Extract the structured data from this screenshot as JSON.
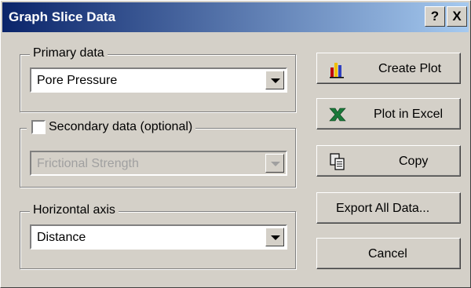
{
  "window": {
    "title": "Graph Slice Data",
    "help_label": "?",
    "close_label": "X"
  },
  "primary": {
    "legend": "Primary data",
    "selected": "Pore Pressure"
  },
  "secondary": {
    "legend": "Secondary data (optional)",
    "checked": false,
    "selected": "Frictional Strength"
  },
  "horizontal": {
    "legend": "Horizontal axis",
    "selected": "Distance"
  },
  "buttons": {
    "create_plot": "Create Plot",
    "plot_excel": "Plot in Excel",
    "copy": "Copy",
    "export": "Export All Data...",
    "cancel": "Cancel"
  }
}
